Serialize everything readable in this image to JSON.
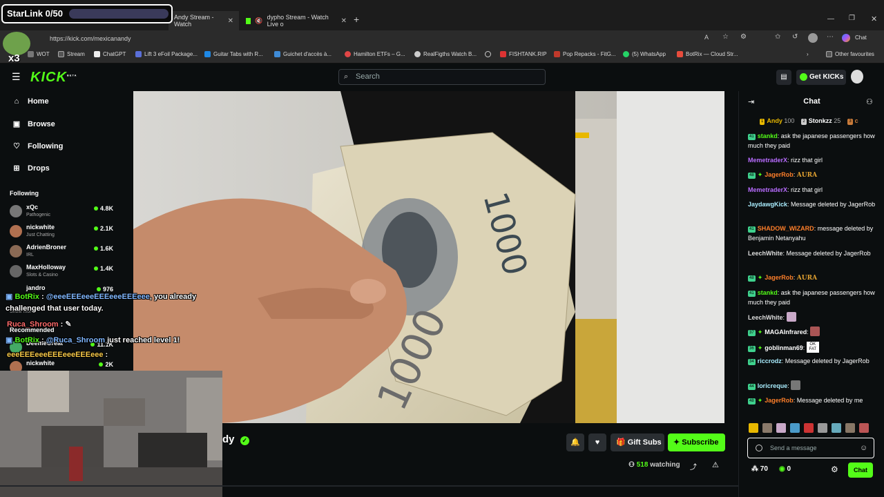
{
  "browser": {
    "tabs": [
      {
        "label": "Andy Stream - Watch"
      },
      {
        "label": "dypho Stream - Watch Live o"
      }
    ],
    "new_tab": "+",
    "url": "https://kick.com/mexicanandy",
    "copilot_label": "Chat",
    "bookmarks": [
      "WOT",
      "Stream",
      "ChatGPT",
      "Lift 3 eFoil Package...",
      "Guitar Tabs with R...",
      "Guichet d'accès à...",
      "Hamilton ETFs – G...",
      "RealFigths Watch B...",
      "FISHTANK.RIP",
      "Pop Repacks - FitG...",
      "(5) WhatsApp",
      "BotRix — Cloud Str..."
    ],
    "other_favourites": "Other favourites"
  },
  "kick": {
    "logo": "KICK",
    "logo_sup": "BETA",
    "search_placeholder": "Search",
    "get_kicks": "Get KICKs"
  },
  "sidebar": {
    "nav": [
      {
        "label": "Home",
        "icon": "home-icon"
      },
      {
        "label": "Browse",
        "icon": "browse-icon"
      },
      {
        "label": "Following",
        "icon": "heart-icon"
      },
      {
        "label": "Drops",
        "icon": "drops-icon"
      }
    ],
    "following_title": "Following",
    "following": [
      {
        "name": "xQc",
        "category": "Pathogenic",
        "viewers": "4.8K"
      },
      {
        "name": "nickwhite",
        "category": "Just Chatting",
        "viewers": "2.1K"
      },
      {
        "name": "AdrienBroner",
        "category": "IRL",
        "viewers": "1.6K"
      },
      {
        "name": "MaxHolloway",
        "category": "Slots & Casino",
        "viewers": "1.4K"
      },
      {
        "name": "jandro",
        "category": "",
        "viewers": "976"
      }
    ],
    "show_more": "Show more",
    "recommended_title": "Recommended",
    "recommended": [
      {
        "name": "DeemeGreat",
        "viewers": "11.1K"
      },
      {
        "name": "nickwhite",
        "viewers": "2K"
      }
    ]
  },
  "overlay": {
    "starlink": "StarLink 0/50",
    "x3": "x3",
    "lines": [
      {
        "user": "BotRix",
        "sep": " : ",
        "mention": "@eeeEEEeeeEEEeeeEEEeee",
        "text": ", you already"
      },
      {
        "text": "challenged that user today."
      },
      {
        "user": "Ruca_Shroom",
        "sep": " : "
      },
      {
        "user": "BotRix",
        "sep": " : ",
        "mention": "@Ruca_Shroom",
        "text": " just reached level 1!"
      },
      {
        "user": "eeeEEEeeeEEEeeeEEEeee",
        "sep": " : "
      }
    ]
  },
  "channel": {
    "name_partial": "dy",
    "watching_count": "518",
    "watching_label": "watching",
    "gift_subs": "Gift Subs",
    "subscribe": "Subscribe"
  },
  "chat": {
    "title": "Chat",
    "leaderboard": [
      {
        "rank": "1",
        "name": "Andy",
        "points": "100"
      },
      {
        "rank": "2",
        "name": "Stonkzz",
        "points": "25"
      },
      {
        "rank": "3",
        "name": "c",
        "points": ""
      }
    ],
    "messages": [
      {
        "badge": "41",
        "user": "stankd",
        "text": "ask the japanese passengers how much they paid",
        "color": "u1"
      },
      {
        "badge": "",
        "user": "MemetraderX",
        "text": "rizz that girl",
        "color": "u2"
      },
      {
        "badge": "48",
        "user": "JagerRob",
        "text": "AURA",
        "color": "u3",
        "star": true
      },
      {
        "badge": "",
        "user": "MemetraderX",
        "text": "rizz that girl",
        "color": "u2"
      },
      {
        "badge": "",
        "user": "JaydawgKick",
        "text": "Message deleted by JagerRob",
        "color": "u4"
      },
      {
        "badge": "41",
        "user": "SHADOW_WIZARD",
        "text": "message deleted by Benjamin Netanyahu",
        "color": "u3"
      },
      {
        "badge": "",
        "user": "LeechWhite",
        "text": "Message deleted by JagerRob",
        "color": "u5"
      },
      {
        "badge": "48",
        "user": "JagerRob",
        "text": "AURA",
        "color": "u3",
        "star": true
      },
      {
        "badge": "41",
        "user": "stankd",
        "text": "ask the japanese passengers how much they paid",
        "color": "u1"
      },
      {
        "badge": "",
        "user": "LeechWhite",
        "text": "",
        "color": "u5"
      },
      {
        "badge": "37",
        "user": "MAGAInfrared",
        "text": "",
        "color": "u6",
        "star": true
      },
      {
        "badge": "36",
        "user": "goblinman69",
        "text": "OK FAT",
        "color": "u6",
        "star": true
      },
      {
        "badge": "34",
        "user": "riccrodz",
        "text": "Message deleted by JagerRob",
        "color": "u4"
      },
      {
        "badge": "44",
        "user": "loricreque",
        "text": "",
        "color": "u4"
      },
      {
        "badge": "48",
        "user": "JagerRob",
        "text": "Message deleted by me",
        "color": "u3",
        "star": true
      }
    ],
    "placeholder": "Send a message",
    "kicks_count": "70",
    "points_count": "0",
    "send_label": "Chat"
  }
}
